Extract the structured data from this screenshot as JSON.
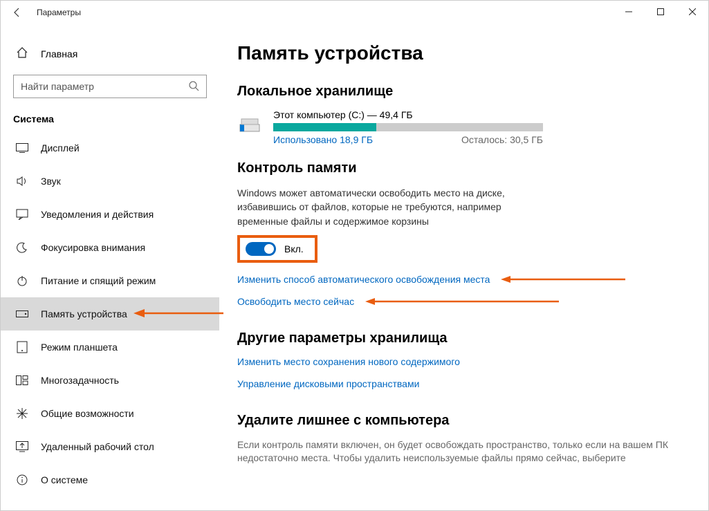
{
  "window": {
    "title": "Параметры"
  },
  "sidebar": {
    "home_label": "Главная",
    "search_placeholder": "Найти параметр",
    "group_label": "Система",
    "items": [
      {
        "label": "Дисплей"
      },
      {
        "label": "Звук"
      },
      {
        "label": "Уведомления и действия"
      },
      {
        "label": "Фокусировка внимания"
      },
      {
        "label": "Питание и спящий режим"
      },
      {
        "label": "Память устройства"
      },
      {
        "label": "Режим планшета"
      },
      {
        "label": "Многозадачность"
      },
      {
        "label": "Общие возможности"
      },
      {
        "label": "Удаленный рабочий стол"
      },
      {
        "label": "О системе"
      }
    ]
  },
  "main": {
    "page_title": "Память устройства",
    "local_storage_heading": "Локальное хранилище",
    "drive": {
      "title": "Этот компьютер (C:) — 49,4 ГБ",
      "used_label": "Использовано 18,9 ГБ",
      "remaining_label": "Осталось: 30,5 ГБ",
      "used_gb": 18.9,
      "total_gb": 49.4
    },
    "sense_heading": "Контроль памяти",
    "sense_desc": "Windows может автоматически освободить место на диске, избавившись от файлов, которые не требуются, например временные файлы и содержимое корзины",
    "toggle_label": "Вкл.",
    "link_change": "Изменить способ автоматического освобождения места",
    "link_free_now": "Освободить место сейчас",
    "other_heading": "Другие параметры хранилища",
    "link_save_loc": "Изменить место сохранения нового содержимого",
    "link_manage_spaces": "Управление дисковыми пространствами",
    "cleanup_heading": "Удалите лишнее с компьютера",
    "cleanup_desc": "Если контроль памяти включен, он будет освобождать пространство, только если на вашем ПК недостаточно места. Чтобы удалить неиспользуемые файлы прямо сейчас, выберите"
  },
  "annotations": {
    "arrow_color": "#e95d0f"
  }
}
